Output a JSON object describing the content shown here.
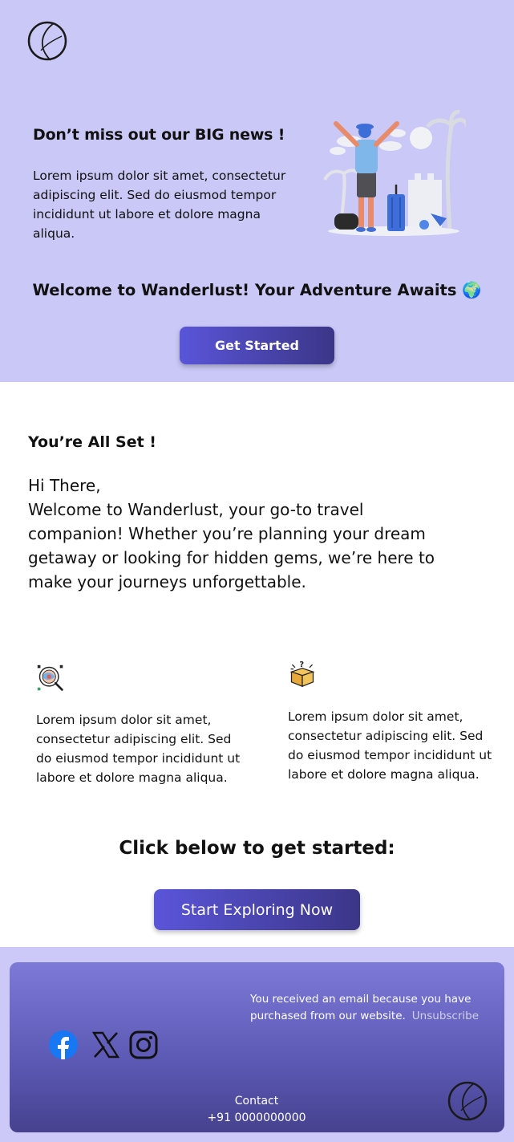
{
  "hero": {
    "title": "Don’t miss out our BIG news !",
    "text": "Lorem ipsum dolor sit amet, consectetur adipiscing elit. Sed do eiusmod tempor incididunt ut labore et dolore magna aliqua.",
    "welcome": "Welcome to Wanderlust! Your Adventure Awaits 🌍",
    "button_label": "Get Started"
  },
  "intro": {
    "title": "You’re All Set !",
    "greeting": "Hi There,",
    "body": "Welcome to Wanderlust, your go-to travel companion! Whether you’re planning your dream getaway or looking for hidden gems, we’re here to make your journeys unforgettable."
  },
  "features": [
    {
      "icon": "explore-map-icon",
      "text": "Lorem ipsum dolor sit amet, consectetur adipiscing elit. Sed do eiusmod tempor incididunt ut labore et dolore magna aliqua."
    },
    {
      "icon": "mystery-box-icon",
      "text": "Lorem ipsum dolor sit amet, consectetur adipiscing elit. Sed do eiusmod tempor incididunt ut labore et dolore magna aliqua."
    }
  ],
  "cta": {
    "heading": "Click below to get started:",
    "button_label": "Start Exploring Now"
  },
  "footer": {
    "note": "You received an email because you have purchased from our website.",
    "unsubscribe": "Unsubscribe",
    "contact_label": "Contact",
    "phone": "+91 0000000000",
    "social": [
      "facebook-icon",
      "x-icon",
      "instagram-icon"
    ]
  },
  "colors": {
    "hero_bg": "#c9c8f6",
    "button_start": "#5a55d9",
    "button_end": "#3b3687",
    "footer_card_top": "#7d7ad8",
    "footer_card_bottom": "#46428f",
    "facebook_blue": "#1877f2"
  }
}
